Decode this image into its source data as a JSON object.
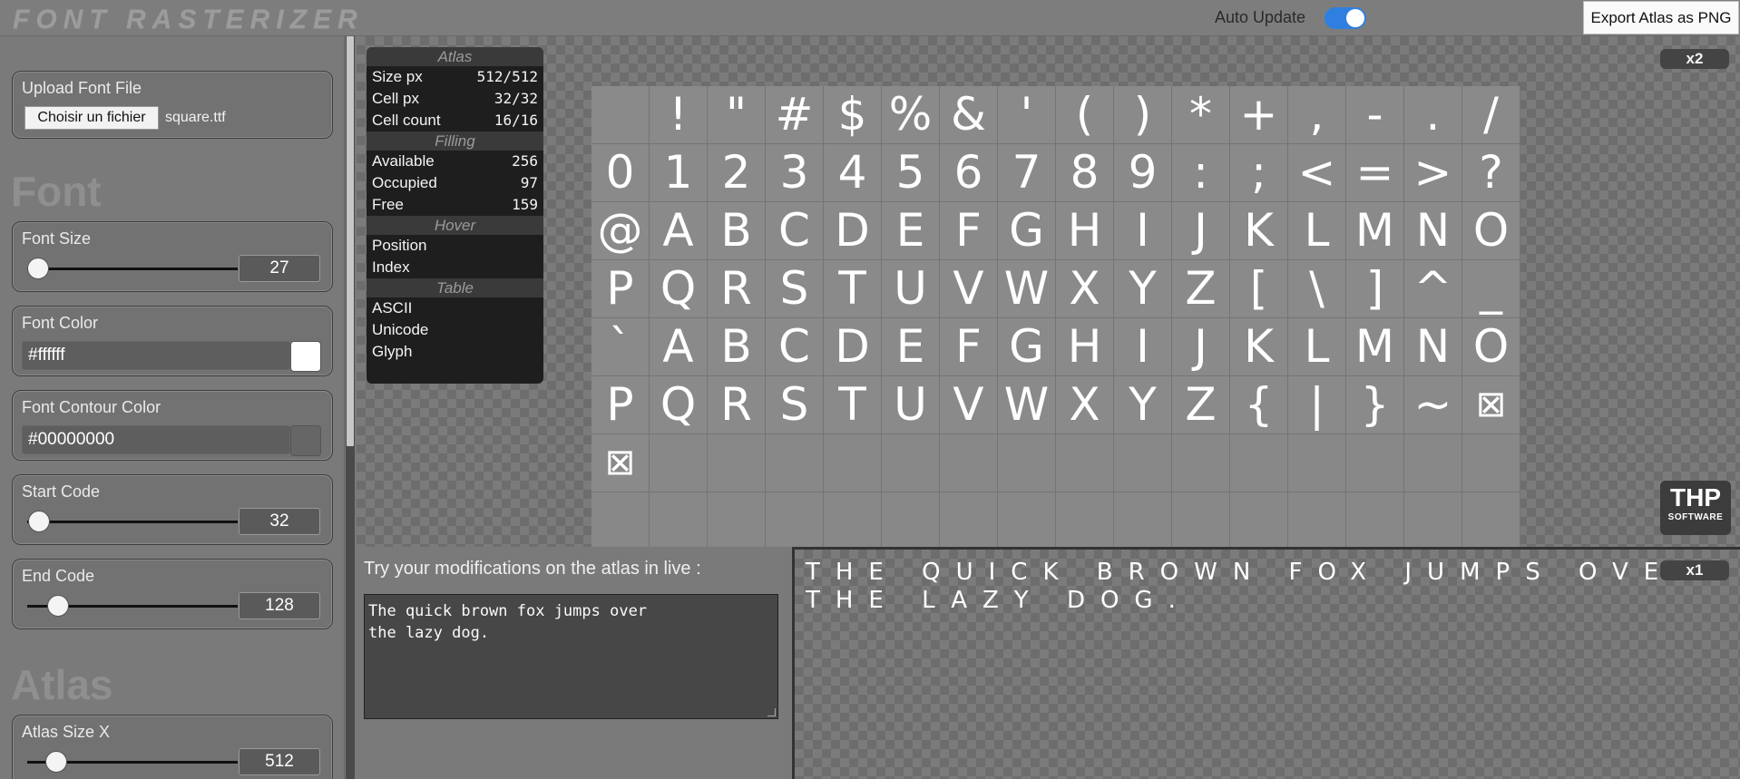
{
  "app": {
    "title": "FONT RASTERIZER",
    "auto_update_label": "Auto Update",
    "auto_update_on": true,
    "export_label": "Export Atlas as PNG"
  },
  "sidebar": {
    "upload": {
      "label": "Upload Font File",
      "button": "Choisir un fichier",
      "file": "square.ttf"
    },
    "font_section": "Font",
    "font_size": {
      "label": "Font Size",
      "value": "27"
    },
    "font_color": {
      "label": "Font Color",
      "value": "#ffffff",
      "swatch": "#ffffff"
    },
    "contour_color": {
      "label": "Font Contour Color",
      "value": "#00000000",
      "swatch": "#666666"
    },
    "start_code": {
      "label": "Start Code",
      "value": "32"
    },
    "end_code": {
      "label": "End Code",
      "value": "128"
    },
    "atlas_section": "Atlas",
    "atlas_size_x": {
      "label": "Atlas Size X",
      "value": "512"
    }
  },
  "info": {
    "atlas_header": "Atlas",
    "size_label": "Size px",
    "size_value": "512/512",
    "cell_label": "Cell px",
    "cell_value": "32/32",
    "count_label": "Cell count",
    "count_value": "16/16",
    "filling_header": "Filling",
    "available_label": "Available",
    "available_value": "256",
    "occupied_label": "Occupied",
    "occupied_value": "97",
    "free_label": "Free",
    "free_value": "159",
    "hover_header": "Hover",
    "position_label": "Position",
    "index_label": "Index",
    "table_header": "Table",
    "ascii_label": "ASCII",
    "unicode_label": "Unicode",
    "glyph_label": "Glyph"
  },
  "atlas": {
    "zoom": "x2",
    "glyphs": [
      " ",
      "!",
      "\"",
      "#",
      "$",
      "%",
      "&",
      "'",
      "(",
      ")",
      "*",
      "+",
      ",",
      "-",
      ".",
      "/",
      "0",
      "1",
      "2",
      "3",
      "4",
      "5",
      "6",
      "7",
      "8",
      "9",
      ":",
      ";",
      "<",
      "=",
      ">",
      "?",
      "@",
      "A",
      "B",
      "C",
      "D",
      "E",
      "F",
      "G",
      "H",
      "I",
      "J",
      "K",
      "L",
      "M",
      "N",
      "O",
      "P",
      "Q",
      "R",
      "S",
      "T",
      "U",
      "V",
      "W",
      "X",
      "Y",
      "Z",
      "[",
      "\\",
      "]",
      "^",
      "_",
      "`",
      "A",
      "B",
      "C",
      "D",
      "E",
      "F",
      "G",
      "H",
      "I",
      "J",
      "K",
      "L",
      "M",
      "N",
      "O",
      "P",
      "Q",
      "R",
      "S",
      "T",
      "U",
      "V",
      "W",
      "X",
      "Y",
      "Z",
      "{",
      "|",
      "}",
      "~",
      "⊠",
      "⊠"
    ],
    "logo_big": "THP",
    "logo_small": "SOFTWARE"
  },
  "live": {
    "label": "Try your modifications on the atlas in live :",
    "text": "The quick brown fox jumps over\nthe lazy dog.",
    "zoom": "x1",
    "preview_line1": "THE QUICK BROWN FOX JUMPS OVER",
    "preview_line2": "THE LAZY DOG."
  }
}
